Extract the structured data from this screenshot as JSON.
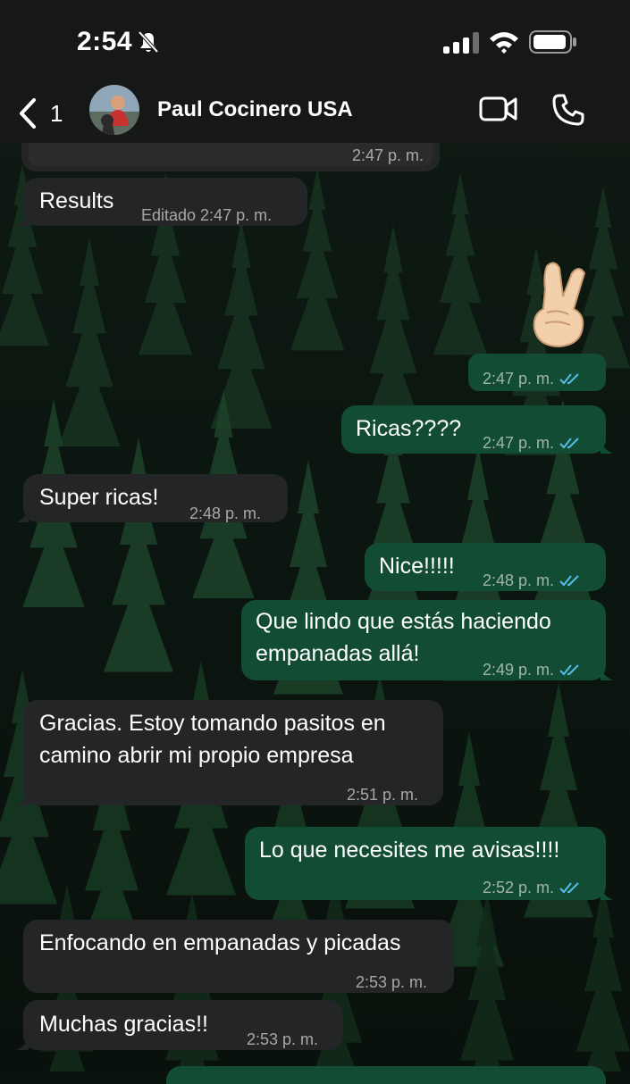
{
  "status_bar": {
    "time": "2:54",
    "silent_icon": "bell-slash-icon",
    "signal_icon": "cellular-signal-icon",
    "wifi_icon": "wifi-icon",
    "battery_icon": "battery-icon"
  },
  "header": {
    "back_count": "1",
    "contact_name": "Paul Cocinero USA",
    "video_icon": "video-call-icon",
    "phone_icon": "phone-call-icon"
  },
  "messages": [
    {
      "direction": "in",
      "text": "",
      "meta": "2:47 p. m."
    },
    {
      "direction": "in",
      "text": "Results",
      "meta": "Editado 2:47 p. m."
    },
    {
      "direction": "out",
      "text": "",
      "emoji": "crossed-fingers",
      "meta": "2:47 p. m."
    },
    {
      "direction": "out",
      "text": "Ricas????",
      "meta": "2:47 p. m."
    },
    {
      "direction": "in",
      "text": "Super ricas!",
      "meta": "2:48 p. m."
    },
    {
      "direction": "out",
      "text": "Nice!!!!!",
      "meta": "2:48 p. m."
    },
    {
      "direction": "out",
      "lines": [
        "Que lindo que estás haciendo",
        "empanadas allá!"
      ],
      "meta": "2:49 p. m."
    },
    {
      "direction": "in",
      "lines": [
        "Gracias. Estoy tomando pasitos en",
        "camino abrir mi propio empresa"
      ],
      "meta": "2:51 p. m."
    },
    {
      "direction": "out",
      "text": "Lo que necesites me avisas!!!!",
      "meta": "2:52 p. m."
    },
    {
      "direction": "in",
      "text": "Enfocando en empanadas y picadas",
      "meta": "2:53 p. m."
    },
    {
      "direction": "in",
      "text": "Muchas gracias!!",
      "meta": "2:53 p. m."
    }
  ],
  "colors": {
    "incoming_bubble": "#232527",
    "outgoing_bubble": "#134c34",
    "read_ticks": "#53bdeb"
  }
}
